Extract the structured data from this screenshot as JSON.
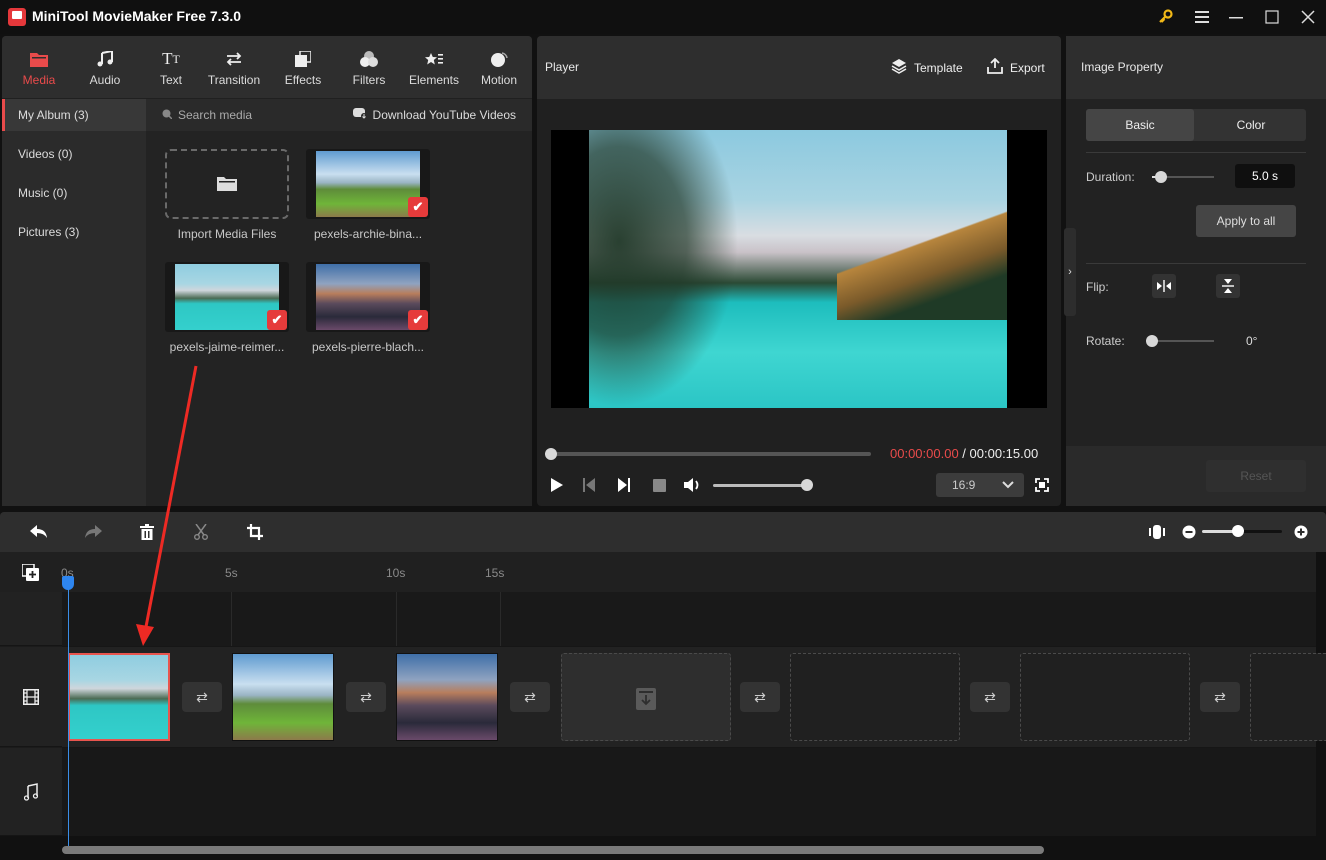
{
  "window": {
    "title": "MiniTool MovieMaker Free 7.3.0",
    "controls": [
      "key-icon",
      "menu-icon",
      "minimize-icon",
      "maximize-icon",
      "close-icon"
    ]
  },
  "colors": {
    "accent": "#e94b4b",
    "playhead": "#2e86f0",
    "upgrade_key": "#f2b817"
  },
  "toolbar": {
    "tabs": [
      {
        "label": "Media",
        "icon": "folder-icon",
        "active": true
      },
      {
        "label": "Audio",
        "icon": "music-note-icon"
      },
      {
        "label": "Text",
        "icon": "text-icon"
      },
      {
        "label": "Transition",
        "icon": "transition-icon"
      },
      {
        "label": "Effects",
        "icon": "effects-icon"
      },
      {
        "label": "Filters",
        "icon": "filters-icon"
      },
      {
        "label": "Elements",
        "icon": "elements-icon"
      },
      {
        "label": "Motion",
        "icon": "motion-icon"
      }
    ]
  },
  "album_nav": {
    "items": [
      {
        "label": "My Album (3)",
        "active": true
      },
      {
        "label": "Videos (0)"
      },
      {
        "label": "Music (0)"
      },
      {
        "label": "Pictures (3)"
      }
    ]
  },
  "media": {
    "search_placeholder": "Search media",
    "download_label": "Download YouTube Videos",
    "import_label": "Import Media Files",
    "items": [
      {
        "name": "pexels-archie-bina...",
        "checked": true
      },
      {
        "name": "pexels-jaime-reimer...",
        "checked": true
      },
      {
        "name": "pexels-pierre-blach...",
        "checked": true
      }
    ]
  },
  "player": {
    "title": "Player",
    "template_label": "Template",
    "export_label": "Export",
    "current_time": "00:00:00.00",
    "separator": " / ",
    "total_time": "00:00:15.00",
    "progress": 0,
    "volume": 1.0,
    "aspect_ratio": "16:9"
  },
  "property": {
    "title": "Image Property",
    "tabs": [
      {
        "label": "Basic",
        "active": true
      },
      {
        "label": "Color"
      }
    ],
    "duration_label": "Duration:",
    "duration_value": "5.0 s",
    "duration_slider": 0.15,
    "apply_all_label": "Apply to all",
    "flip_label": "Flip:",
    "rotate_label": "Rotate:",
    "rotate_value": "0°",
    "rotate_slider": 0,
    "reset_label": "Reset"
  },
  "timeline": {
    "toolbar": [
      "undo-icon",
      "redo-icon",
      "delete-icon",
      "split-icon",
      "crop-icon"
    ],
    "zoom_level": 0.45,
    "ruler_ticks": [
      "0s",
      "5s",
      "10s",
      "15s"
    ],
    "playhead_time": "0s",
    "clips": [
      {
        "name": "pexels-jaime-reimer",
        "selected": true
      },
      {
        "name": "pexels-archie-bina"
      },
      {
        "name": "pexels-pierre-blach"
      }
    ],
    "empty_slots": 4
  }
}
